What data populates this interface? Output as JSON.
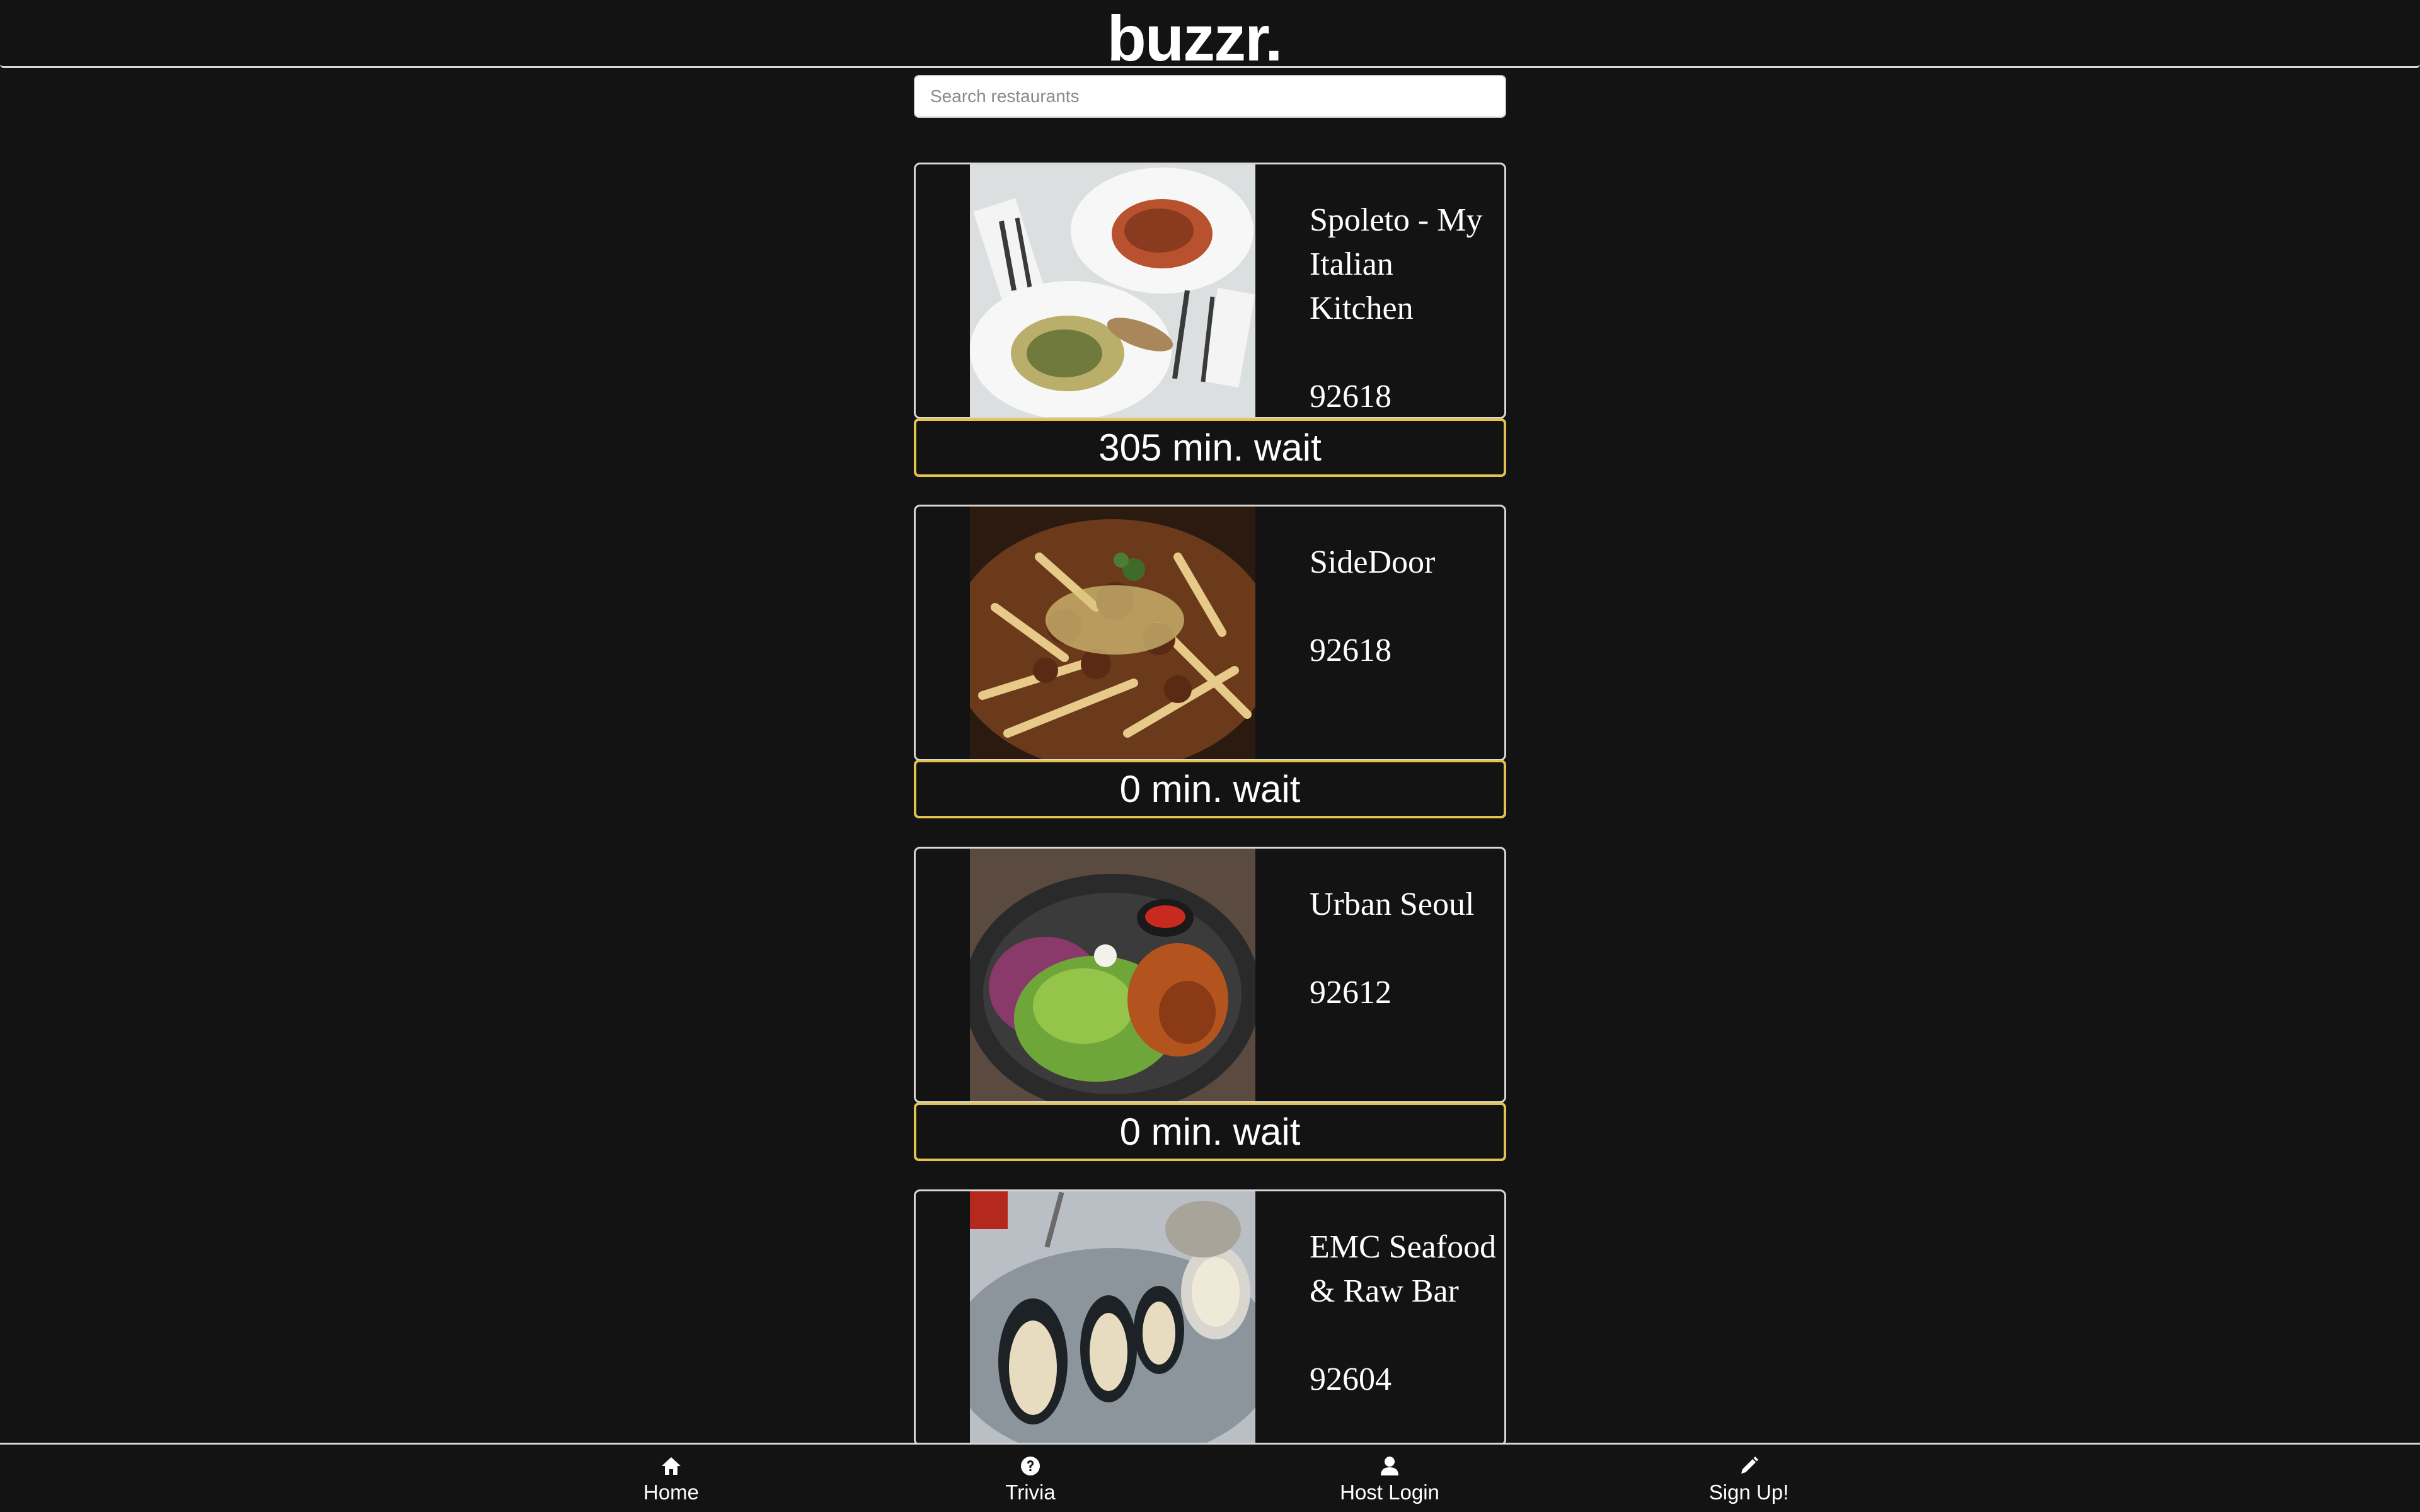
{
  "app": {
    "logo": "buzzr."
  },
  "search": {
    "placeholder": "Search restaurants",
    "value": ""
  },
  "restaurants": [
    {
      "name": "Spoleto - My Italian Kitchen",
      "zip": "92618",
      "wait": "305 min. wait",
      "image": "pasta-dishes-photo"
    },
    {
      "name": "SideDoor",
      "zip": "92618",
      "wait": "0 min. wait",
      "image": "chili-fries-photo"
    },
    {
      "name": "Urban Seoul",
      "zip": "92612",
      "wait": "0 min. wait",
      "image": "salad-bowl-photo"
    },
    {
      "name": "EMC Seafood & Raw Bar",
      "zip": "92604",
      "wait": "",
      "image": "oysters-mussels-photo"
    }
  ],
  "nav": [
    {
      "label": "Home",
      "icon": "home-icon"
    },
    {
      "label": "Trivia",
      "icon": "question-circle-icon"
    },
    {
      "label": "Host Login",
      "icon": "user-icon"
    },
    {
      "label": "Sign Up!",
      "icon": "pencil-icon"
    }
  ],
  "colors": {
    "background": "#131313",
    "accent_wait_border": "#e3c24d",
    "card_border": "#d9d9d9",
    "text": "#ffffff"
  }
}
